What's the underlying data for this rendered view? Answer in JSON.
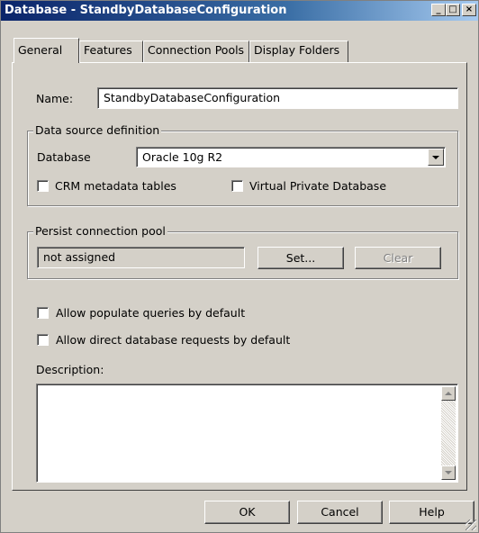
{
  "window": {
    "title": "Database - StandbyDatabaseConfiguration",
    "min_glyph": "_",
    "max_glyph": "□",
    "close_glyph": "×"
  },
  "tabs": [
    {
      "label": "General",
      "active": true
    },
    {
      "label": "Features",
      "active": false
    },
    {
      "label": "Connection Pools",
      "active": false
    },
    {
      "label": "Display Folders",
      "active": false
    }
  ],
  "general": {
    "name_label": "Name:",
    "name_value": "StandbyDatabaseConfiguration",
    "datasource": {
      "group_label": "Data source definition",
      "database_label": "Database",
      "database_value": "Oracle 10g R2",
      "crm_label": "CRM metadata tables",
      "crm_checked": false,
      "vpd_label": "Virtual Private Database",
      "vpd_checked": false
    },
    "persist": {
      "group_label": "Persist connection pool",
      "value": "not assigned",
      "set_label": "Set...",
      "clear_label": "Clear"
    },
    "allow_populate_label": "Allow populate queries by default",
    "allow_direct_label": "Allow direct database requests by default",
    "description_label": "Description:",
    "description_value": ""
  },
  "footer": {
    "ok_label": "OK",
    "cancel_label": "Cancel",
    "help_label": "Help"
  }
}
